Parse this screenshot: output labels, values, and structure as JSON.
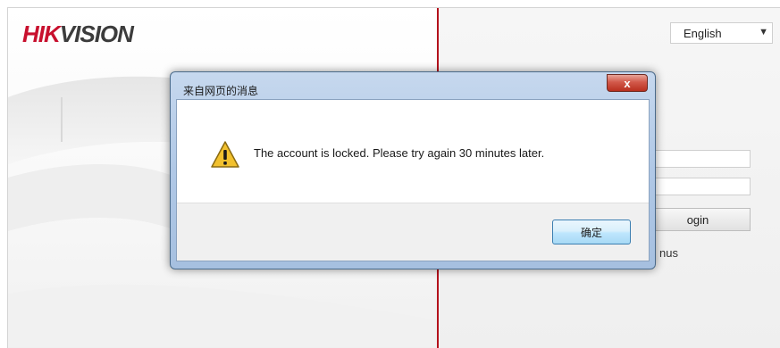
{
  "header": {
    "logo_primary": "HIK",
    "logo_secondary": "VISION"
  },
  "language_select": {
    "selected": "English"
  },
  "login": {
    "button_label_fragment": "ogin",
    "status_fragment": "nus"
  },
  "dialog": {
    "title": "来自网页的消息",
    "close_label": "x",
    "message": "The account is locked. Please try again 30 minutes later.",
    "ok_label": "确定"
  },
  "colors": {
    "brand_red": "#c8102e",
    "divider_red": "#b4121c",
    "dialog_frame": "#b0c8e6"
  }
}
